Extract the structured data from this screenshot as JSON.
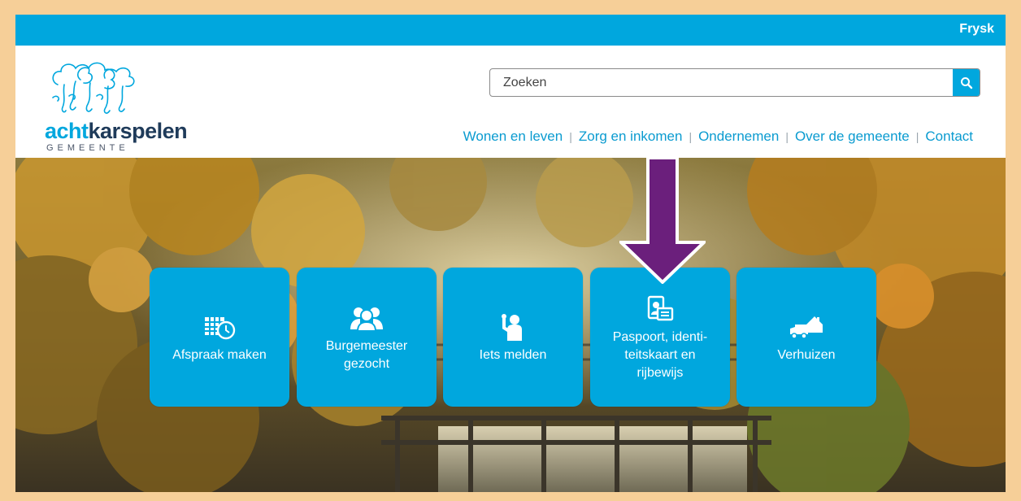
{
  "topbar": {
    "language_link": "Frysk"
  },
  "header": {
    "logo": {
      "word_part_a": "acht",
      "word_part_b": "karspelen",
      "subtitle": "GEMEENTE"
    },
    "search": {
      "placeholder": "Zoeken",
      "icon": "search-icon"
    },
    "nav": {
      "items": [
        "Wonen en leven",
        "Zorg en inkomen",
        "Ondernemen",
        "Over de gemeente",
        "Contact"
      ]
    }
  },
  "tiles": [
    {
      "label": "Afspraak maken",
      "icon": "calendar-clock-icon"
    },
    {
      "label": "Burgemeester\ngezocht",
      "icon": "people-group-icon"
    },
    {
      "label": "Iets melden",
      "icon": "report-person-icon"
    },
    {
      "label": "Paspoort, identi-\nteitskaart en\nrijbewijs",
      "icon": "id-documents-icon"
    },
    {
      "label": "Verhuizen",
      "icon": "moving-truck-icon"
    }
  ],
  "colors": {
    "brand_blue": "#00a7de",
    "navy": "#1f3b5a",
    "arrow_purple": "#6b1f7c",
    "page_border": "#f6cf98"
  }
}
